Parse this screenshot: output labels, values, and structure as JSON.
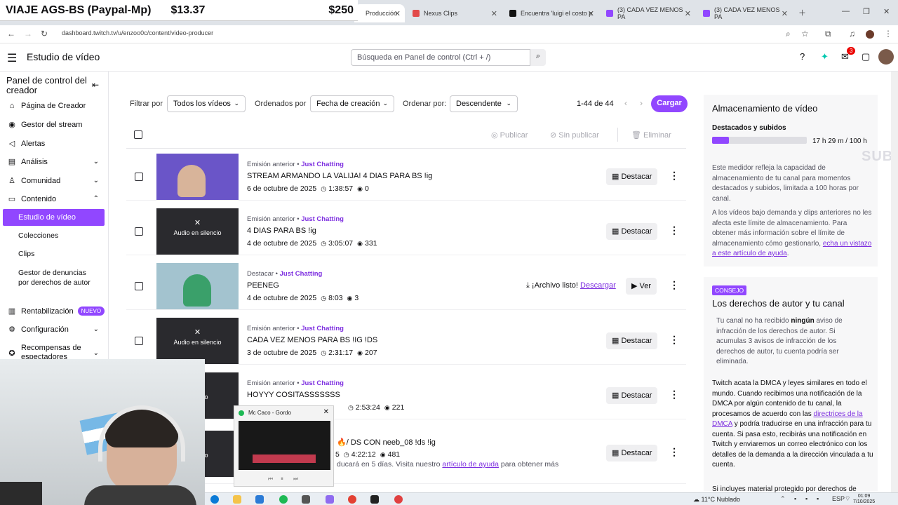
{
  "overlay": {
    "title": "VIAJE AGS-BS (Paypal-Mp)",
    "amount_current": "$13.37",
    "amount_goal": "$250"
  },
  "browser": {
    "tabs": [
      {
        "label": "Producción",
        "color": "#9147ff"
      },
      {
        "label": "Nexus Clips",
        "color": "#e24a4a"
      },
      {
        "label": "Encuentra 'luigi el costo p",
        "color": "#111111"
      },
      {
        "label": "(3) CADA VEZ MENOS PA",
        "color": "#9147ff"
      },
      {
        "label": "(3) CADA VEZ MENOS PA",
        "color": "#9147ff"
      }
    ],
    "url": "dashboard.twitch.tv/u/enzoo0c/content/video-producer"
  },
  "header": {
    "title": "Estudio de vídeo",
    "search_placeholder": "Búsqueda en Panel de control (Ctrl + /)",
    "notif_count": "3"
  },
  "sidebar": {
    "title": "Panel de control del creador",
    "items": [
      {
        "label": "Página de Creador",
        "icon": "home-icon"
      },
      {
        "label": "Gestor del stream",
        "icon": "broadcast-icon"
      },
      {
        "label": "Alertas",
        "icon": "megaphone-icon"
      },
      {
        "label": "Análisis",
        "icon": "analytics-icon"
      },
      {
        "label": "Comunidad",
        "icon": "community-icon"
      },
      {
        "label": "Contenido",
        "icon": "content-icon"
      }
    ],
    "sub_items": [
      "Estudio de vídeo",
      "Colecciones",
      "Clips",
      "Gestor de denuncias por derechos de autor"
    ],
    "bottom_items": [
      {
        "label": "Rentabilización",
        "badge": "NUEVO"
      },
      {
        "label": "Configuración"
      },
      {
        "label": "Recompensas de espectadores"
      }
    ]
  },
  "filters": {
    "filter_label": "Filtrar por",
    "filter_value": "Todos los vídeos",
    "sort_label": "Ordenados por",
    "sort_value": "Fecha de creación",
    "order_label": "Ordenar por:",
    "order_value": "Descendente",
    "range": "1-44 de 44",
    "upload": "Cargar"
  },
  "toolbar": {
    "publish": "Publicar",
    "unpublish": "Sin publicar",
    "delete": "Eliminar"
  },
  "videos": [
    {
      "type": "Emisión anterior",
      "category": "Just Chatting",
      "title": "STREAM ARMANDO LA VALIJA! 4 DIAS PARA BS !ig",
      "date": "6 de octubre de 2025",
      "duration": "1:38:57",
      "views": "0",
      "action": "Destacar",
      "muted": ""
    },
    {
      "type": "Emisión anterior",
      "category": "Just Chatting",
      "title": "4 DIAS PARA BS !ig",
      "date": "4 de octubre de 2025",
      "duration": "3:05:07",
      "views": "331",
      "action": "Destacar",
      "muted": "Audio en silencio"
    },
    {
      "type": "Destacar",
      "category": "Just Chatting",
      "title": "PEENEG",
      "date": "4 de octubre de 2025",
      "duration": "8:03",
      "views": "3",
      "action": "Ver",
      "muted": "",
      "ready": "¡Archivo listo!",
      "download": "Descargar"
    },
    {
      "type": "Emisión anterior",
      "category": "Just Chatting",
      "title": "CADA VEZ MENOS PARA BS !IG !DS",
      "date": "3 de octubre de 2025",
      "duration": "2:31:17",
      "views": "207",
      "action": "Destacar",
      "muted": "Audio en silencio"
    },
    {
      "type": "Emisión anterior",
      "category": "Just Chatting",
      "title": "HOYYY COSITASSSSSSS",
      "date": "",
      "duration": "2:53:24",
      "views": "221",
      "action": "Destacar",
      "muted": "silencio"
    },
    {
      "type": "",
      "category": "",
      "title": "/ DS CON neeb_08 !ds !ig",
      "date": "5",
      "duration": "4:22:12",
      "views": "481",
      "action": "Destacar",
      "muted": "silencio",
      "note": "ducará en 5 días. Visita nuestro",
      "note_link": "artículo de ayuda",
      "note_tail": "para obtener más"
    }
  ],
  "storage": {
    "title": "Almacenamiento de vídeo",
    "subtitle": "Destacados y subidos",
    "usage": "17 h 29 m / 100 h",
    "fill_fraction": 0.175,
    "text1": "Este medidor refleja la capacidad de almacenamiento de tu canal para momentos destacados y subidos, limitada a 100 horas por canal.",
    "text2": "A los vídeos bajo demanda y clips anteriores no les afecta este límite de almacenamiento. Para obtener más información sobre el límite de almacenamiento cómo gestionarlo,",
    "link": "echa un vistazo a este artículo de ayuda",
    "ghost": "SUB"
  },
  "copyright": {
    "badge": "CONSEJO",
    "title": "Los derechos de autor y tu canal",
    "p1_a": "Tu canal no ha recibido",
    "p1_b": "ningún",
    "p1_c": "aviso de infracción de los derechos de autor. Si acumulas 3 avisos de infracción de los derechos de autor, tu cuenta podría ser eliminada.",
    "p2_a": "Twitch acata la DMCA y leyes similares en todo el mundo. Cuando recibimos una notificación de la DMCA por algún contenido de tu canal, la procesamos de acuerdo con las",
    "p2_link": "directrices de la DMCA",
    "p2_b": "y podría traducirse en una infracción para tu cuenta. Si pasa esto, recibirás una notificación en Twitch y enviaremos un correo electrónico con los detalles de la demanda a la dirección vinculada a tu cuenta.",
    "p3": "Si incluyes material protegido por derechos de"
  },
  "preview": {
    "title": "Mc Caco - Gordo"
  },
  "taskbar": {
    "weather": "11°C  Nublado",
    "lang": "ESP",
    "time": "01:09",
    "date": "7/10/2025"
  },
  "icons": {
    "accent": "#9147ff"
  }
}
